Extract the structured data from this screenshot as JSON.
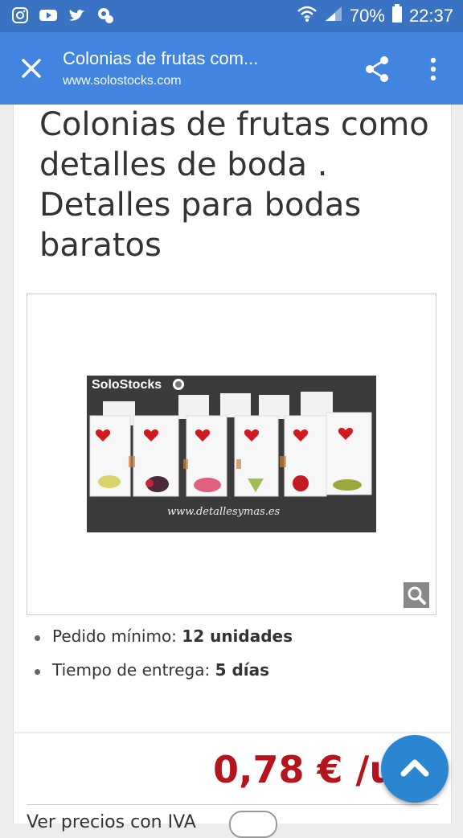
{
  "status_bar": {
    "battery": "70%",
    "time": "22:37"
  },
  "app_bar": {
    "title": "Colonias de frutas com...",
    "url": "www.solostocks.com"
  },
  "product": {
    "title": "Colonias de frutas como detalles de boda . Detalles para bodas baratos",
    "photo_brand": "SoloStocks",
    "photo_watermark": "www.detallesymas.es",
    "specs": [
      {
        "label": "Pedido mínimo:",
        "value": "12 unidades"
      },
      {
        "label": "Tiempo de entrega:",
        "value": "5 días"
      }
    ]
  },
  "price": {
    "value": "0,78 € /uni",
    "vat_label": "Ver precios con IVA"
  },
  "colors": {
    "status_bar": "#3a73c4",
    "app_bar": "#4185e0",
    "price": "#b5141c",
    "fab": "#2a86d1"
  }
}
